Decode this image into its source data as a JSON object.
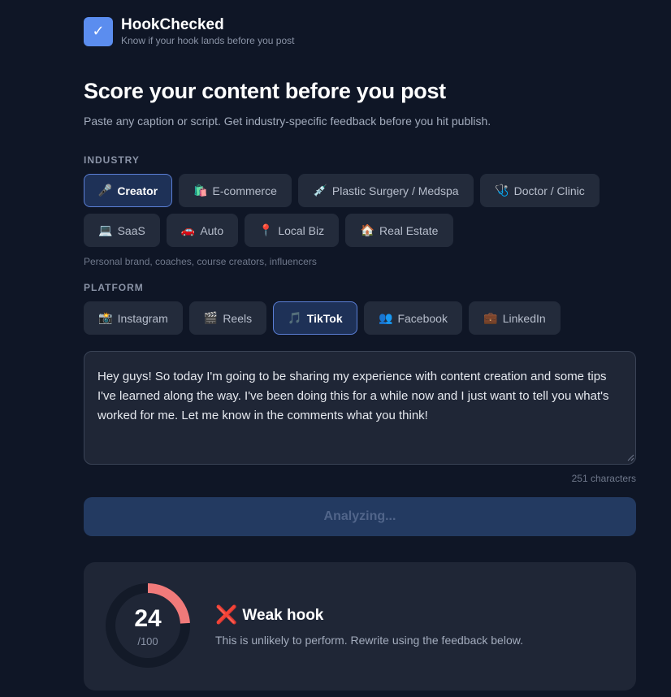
{
  "brand": {
    "logo_icon": "check-icon",
    "name": "HookChecked",
    "tagline": "Know if your hook lands before you post"
  },
  "page": {
    "title": "Score your content before you post",
    "subtitle": "Paste any caption or script. Get industry-specific feedback before you hit publish."
  },
  "industry": {
    "label": "INDUSTRY",
    "options": [
      {
        "icon": "🎤",
        "label": "Creator",
        "active": true
      },
      {
        "icon": "🛍️",
        "label": "E-commerce",
        "active": false
      },
      {
        "icon": "💉",
        "label": "Plastic Surgery / Medspa",
        "active": false
      },
      {
        "icon": "🩺",
        "label": "Doctor / Clinic",
        "active": false
      },
      {
        "icon": "💻",
        "label": "SaaS",
        "active": false
      },
      {
        "icon": "🚗",
        "label": "Auto",
        "active": false
      },
      {
        "icon": "📍",
        "label": "Local Biz",
        "active": false
      },
      {
        "icon": "🏠",
        "label": "Real Estate",
        "active": false
      }
    ],
    "hint": "Personal brand, coaches, course creators, influencers"
  },
  "platform": {
    "label": "PLATFORM",
    "options": [
      {
        "icon": "📸",
        "label": "Instagram",
        "active": false
      },
      {
        "icon": "🎬",
        "label": "Reels",
        "active": false
      },
      {
        "icon": "🎵",
        "label": "TikTok",
        "active": true
      },
      {
        "icon": "👥",
        "label": "Facebook",
        "active": false
      },
      {
        "icon": "💼",
        "label": "LinkedIn",
        "active": false
      }
    ]
  },
  "editor": {
    "value": "Hey guys! So today I'm going to be sharing my experience with content creation and some tips I've learned along the way. I've been doing this for a while now and I just want to tell you what's worked for me. Let me know in the comments what you think!",
    "char_count": "251 characters"
  },
  "analyze_button": {
    "label": "Analyzing..."
  },
  "result": {
    "score": "24",
    "max": "/100",
    "score_fraction": 0.24,
    "verdict_icon": "❌",
    "verdict": "Weak hook",
    "description": "This is unlikely to perform. Rewrite using the feedback below.",
    "colors": {
      "gauge": "#f07a7a",
      "track": "#131a28",
      "verdict_icon": "#e0453a"
    }
  },
  "colors": {
    "background": "#0f1626",
    "accent": "#5b8def",
    "active_chip_bg": "#1e3157",
    "active_chip_border": "#5b7fd6"
  }
}
